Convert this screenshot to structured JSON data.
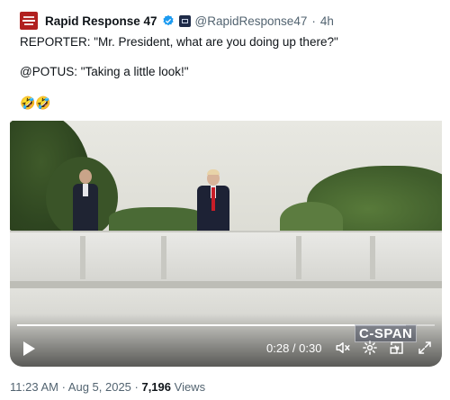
{
  "post": {
    "display_name": "Rapid Response 47",
    "handle": "@RapidResponse47",
    "separator": "·",
    "time_ago": "4h",
    "lines": [
      "REPORTER: \"Mr. President, what are you doing up there?\"",
      "@POTUS: \"Taking a little look!\"",
      "🤣🤣"
    ]
  },
  "video": {
    "time_current": "0:28",
    "time_separator": " / ",
    "time_total": "0:30",
    "progress": 0.93,
    "watermark": "C-SPAN",
    "icons": [
      "play-icon",
      "mute-icon",
      "settings-icon",
      "picture-in-picture-icon",
      "fullscreen-icon"
    ]
  },
  "footer": {
    "timestamp": "11:23 AM · Aug 5, 2025 · ",
    "views_count": "7,196",
    "views_label": " Views"
  },
  "colors": {
    "brand": "#b1201f",
    "verified": "#1d9bf0",
    "muted_text": "#536471",
    "primary_text": "#0f1419"
  }
}
